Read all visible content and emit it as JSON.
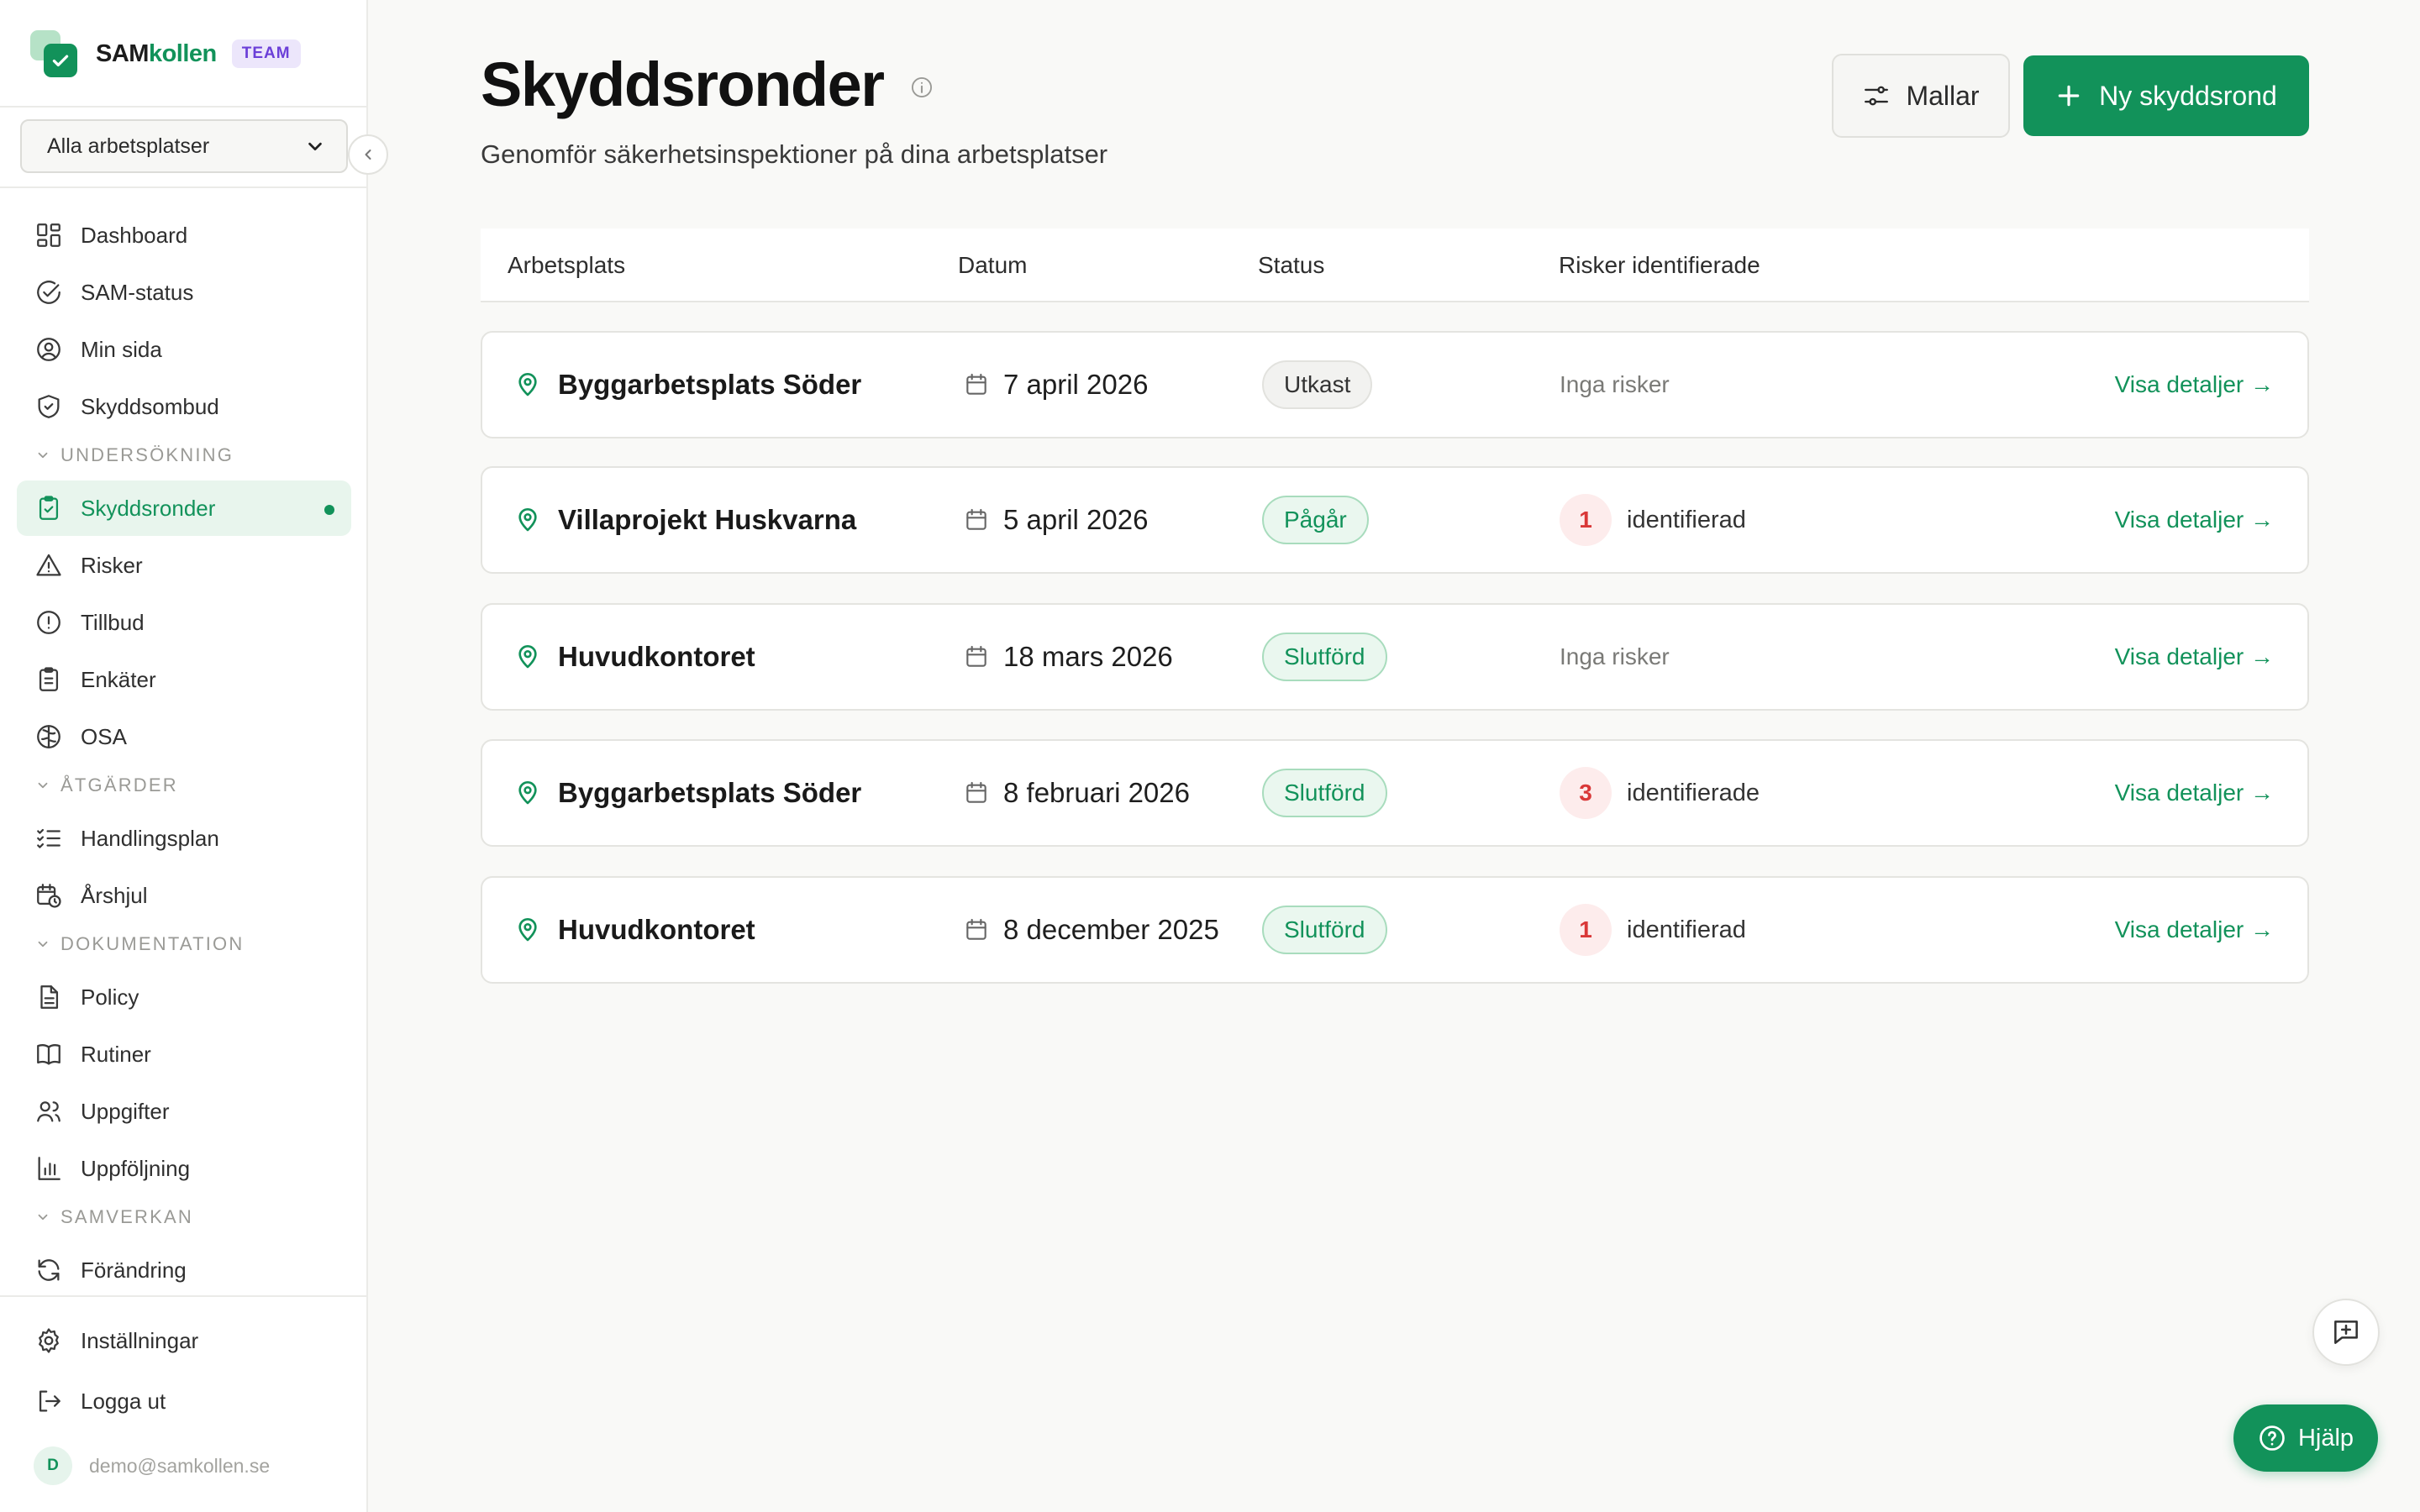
{
  "app": {
    "brand_part1": "SAM",
    "brand_part2": "kollen",
    "plan_badge": "TEAM",
    "workplace_select": "Alla arbetsplatser",
    "user_initial": "D",
    "user_email": "demo@samkollen.se"
  },
  "sidebar": {
    "top_items": [
      {
        "label": "Dashboard",
        "icon": "dashboard-icon"
      },
      {
        "label": "SAM-status",
        "icon": "check-circle-icon"
      },
      {
        "label": "Min sida",
        "icon": "user-circle-icon"
      },
      {
        "label": "Skyddsombud",
        "icon": "shield-icon"
      }
    ],
    "sections": [
      {
        "label": "UNDERSÖKNING",
        "items": [
          {
            "label": "Skyddsronder",
            "icon": "clipboard-check-icon",
            "active": true
          },
          {
            "label": "Risker",
            "icon": "warning-icon"
          },
          {
            "label": "Tillbud",
            "icon": "alert-circle-icon"
          },
          {
            "label": "Enkäter",
            "icon": "clipboard-list-icon"
          },
          {
            "label": "OSA",
            "icon": "brain-icon"
          }
        ]
      },
      {
        "label": "ÅTGÄRDER",
        "items": [
          {
            "label": "Handlingsplan",
            "icon": "list-check-icon"
          },
          {
            "label": "Årshjul",
            "icon": "calendar-clock-icon"
          }
        ]
      },
      {
        "label": "DOKUMENTATION",
        "items": [
          {
            "label": "Policy",
            "icon": "document-icon"
          },
          {
            "label": "Rutiner",
            "icon": "book-icon"
          },
          {
            "label": "Uppgifter",
            "icon": "users-icon"
          },
          {
            "label": "Uppföljning",
            "icon": "bar-chart-icon"
          }
        ]
      },
      {
        "label": "SAMVERKAN",
        "items": [
          {
            "label": "Förändring",
            "icon": "refresh-icon"
          }
        ]
      }
    ],
    "bottom_items": [
      {
        "label": "Inställningar",
        "icon": "gear-icon"
      },
      {
        "label": "Logga ut",
        "icon": "logout-icon"
      }
    ]
  },
  "main": {
    "title": "Skyddsronder",
    "subtitle": "Genomför säkerhetsinspektioner på dina arbetsplatser",
    "templates_button": "Mallar",
    "new_button": "Ny skyddsrond",
    "columns": [
      "Arbetsplats",
      "Datum",
      "Status",
      "Risker identifierade"
    ],
    "rows": [
      {
        "workplace": "Byggarbetsplats Söder",
        "date": "7 april 2026",
        "status": "Utkast",
        "status_kind": "draft",
        "risk_count": "",
        "risk_text": "Inga risker",
        "link": "Visa detaljer →"
      },
      {
        "workplace": "Villaprojekt Huskvarna",
        "date": "5 april 2026",
        "status": "Pågår",
        "status_kind": "green",
        "risk_count": "1",
        "risk_text": "identifierad",
        "link": "Visa detaljer →"
      },
      {
        "workplace": "Huvudkontoret",
        "date": "18 mars 2026",
        "status": "Slutförd",
        "status_kind": "green",
        "risk_count": "",
        "risk_text": "Inga risker",
        "link": "Visa detaljer →"
      },
      {
        "workplace": "Byggarbetsplats Söder",
        "date": "8 februari 2026",
        "status": "Slutförd",
        "status_kind": "green",
        "risk_count": "3",
        "risk_text": "identifierade",
        "link": "Visa detaljer →"
      },
      {
        "workplace": "Huvudkontoret",
        "date": "8 december 2025",
        "status": "Slutförd",
        "status_kind": "green",
        "risk_count": "1",
        "risk_text": "identifierad",
        "link": "Visa detaljer →"
      }
    ]
  },
  "help_button": "Hjälp",
  "colors": {
    "accent": "#12925a",
    "risk": "#d93838",
    "badge": "#6b3fd8"
  }
}
